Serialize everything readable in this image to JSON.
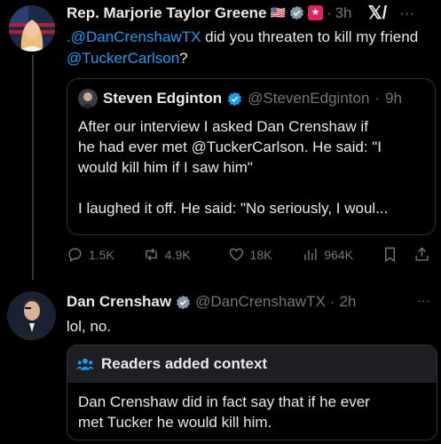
{
  "post": {
    "author_name": "Rep. Marjorie Taylor Greene",
    "flag_emoji": "🇺🇸",
    "time": "3h",
    "more": "···",
    "text_mention": ".@DanCrenshawTX",
    "text_mid": " did you threaten to kill my friend ",
    "text_mention2": "@TuckerCarlson",
    "text_end": "?",
    "colors": {
      "accent": "#1d9bf0",
      "verified": "#1d9bf0",
      "gov_badge": "#829aab",
      "party_badge": "#e0245e"
    }
  },
  "quote": {
    "author_name": "Steven Edginton",
    "handle": "@StevenEdginton",
    "time": "9h",
    "line1": "After our interview I asked Dan Crenshaw if",
    "line2": "he had ever met @TuckerCarlson. He said: \"I",
    "line3": "would kill him if I saw him\"",
    "line4": "I laughed it off. He said: \"No seriously, I woul..."
  },
  "actions": {
    "replies": "1.5K",
    "reposts": "4.9K",
    "likes": "18K",
    "views": "964K"
  },
  "reply": {
    "author_name": "Dan Crenshaw",
    "handle": "@DanCrenshawTX",
    "time": "2h",
    "more": "···",
    "text": "lol, no."
  },
  "context": {
    "title": "Readers added context",
    "line1": "Dan Crenshaw did in fact say that if he ever",
    "line2": "met Tucker he would kill him."
  }
}
